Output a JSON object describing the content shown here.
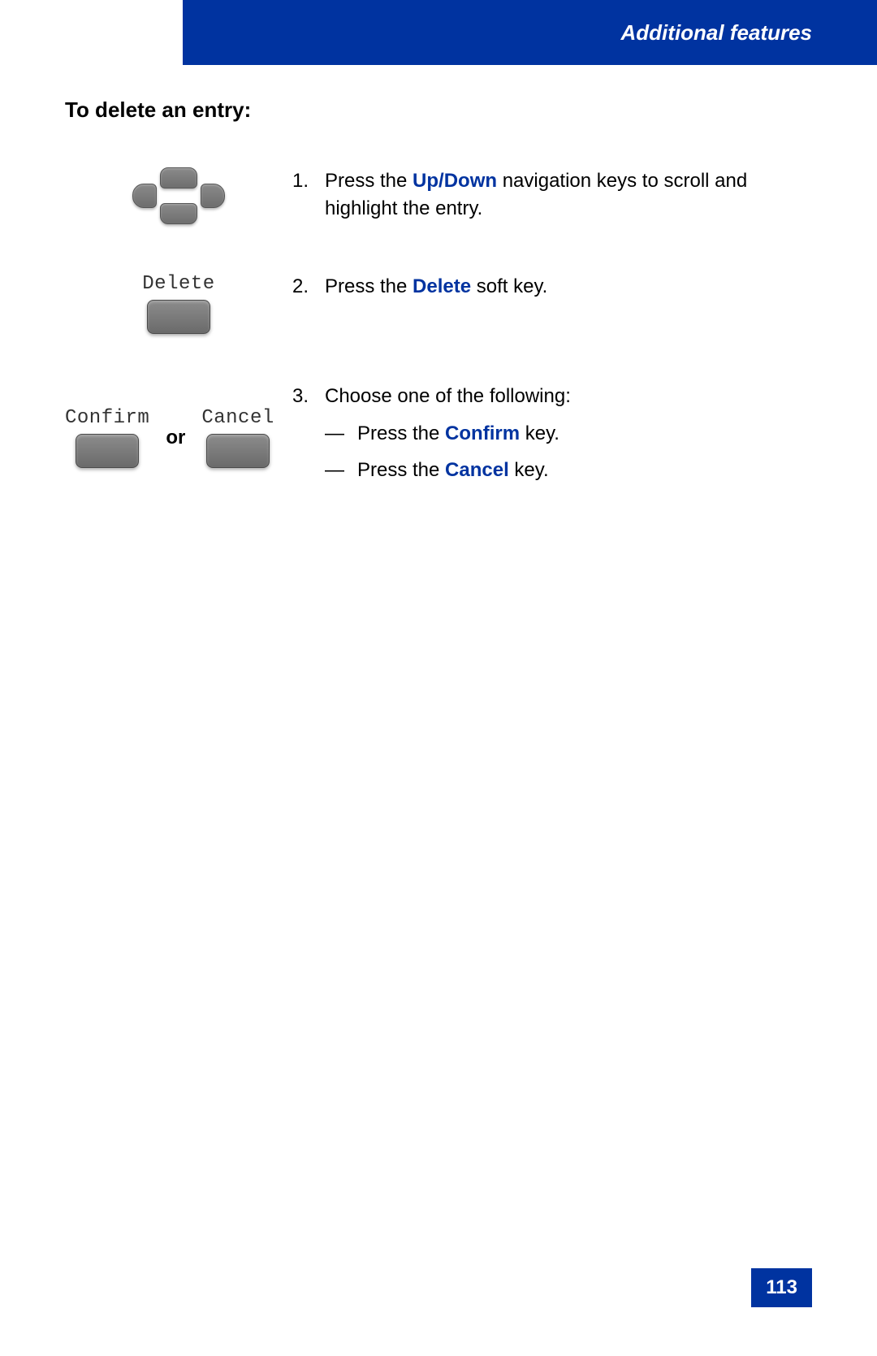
{
  "header": {
    "title": "Additional features"
  },
  "page_number": "113",
  "section_heading": "To delete an entry:",
  "steps": [
    {
      "num": "1.",
      "text_before": "Press the ",
      "keyword": "Up/Down",
      "text_after": " navigation keys to scroll and highlight the entry."
    },
    {
      "num": "2.",
      "text_before": "Press the ",
      "keyword": "Delete",
      "text_after": " soft key.",
      "softkey_label": "Delete"
    },
    {
      "num": "3.",
      "intro": "Choose one of the following:",
      "options": [
        {
          "dash": "—",
          "text_before": "Press the ",
          "keyword": "Confirm",
          "text_after": " key."
        },
        {
          "dash": "—",
          "text_before": "Press the ",
          "keyword": "Cancel",
          "text_after": " key."
        }
      ],
      "confirm_label": "Confirm",
      "cancel_label": "Cancel",
      "or_label": "or"
    }
  ]
}
